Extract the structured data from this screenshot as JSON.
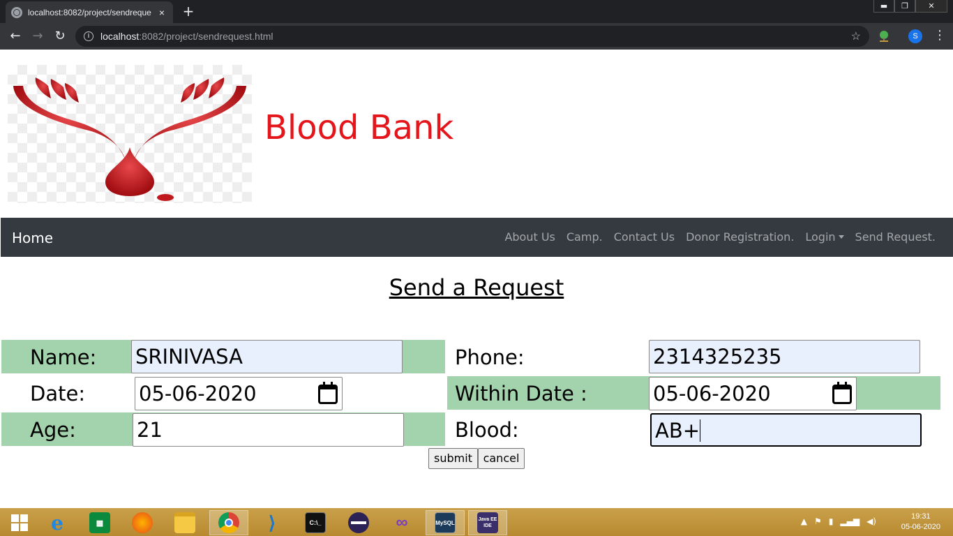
{
  "browser": {
    "tab_title": "localhost:8082/project/sendreque",
    "tab_close": "×",
    "new_tab": "+",
    "window_controls": [
      "▬",
      "❐",
      "✕"
    ],
    "url_host": "localhost",
    "url_path": ":8082/project/sendrequest.html",
    "profile_initial": "S",
    "back": "←",
    "forward": "→",
    "reload": "↻",
    "star": "☆",
    "menu": "⋮"
  },
  "site": {
    "title": "Blood Bank"
  },
  "navbar": {
    "brand": "Home",
    "links": [
      "About Us",
      "Camp.",
      "Contact Us",
      "Donor Registration.",
      "Login",
      "Send Request."
    ]
  },
  "page": {
    "heading": "Send a Request"
  },
  "form": {
    "name_label": "Name:",
    "name_value": "SRINIVASA",
    "phone_label": "Phone:",
    "phone_value": "2314325235",
    "date_label": "Date:",
    "date_value": "05-06-2020",
    "within_label": "Within Date :",
    "within_value": "05-06-2020",
    "age_label": "Age:",
    "age_value": "21",
    "blood_label": "Blood:",
    "blood_value": "AB+",
    "submit_label": "submit",
    "cancel_label": "cancel"
  },
  "colors": {
    "title_red": "#e4161b",
    "navbar_bg": "#343a40",
    "row_green": "#a3d3ac",
    "autofill_bg": "#e8f0fe"
  },
  "taskbar": {
    "icons": [
      "windows-start-icon",
      "internet-explorer-icon",
      "store-icon",
      "firefox-icon",
      "file-explorer-icon",
      "chrome-icon",
      "vscode-icon",
      "cmd-icon",
      "eclipse-icon",
      "visual-studio-icon",
      "mysql-icon",
      "java-ee-ide-icon"
    ],
    "mysql_label": "MySQL",
    "javaee_label": "Java EE IDE",
    "cmd_label": "C:\\_",
    "time": "19:31",
    "date": "05-06-2020"
  }
}
